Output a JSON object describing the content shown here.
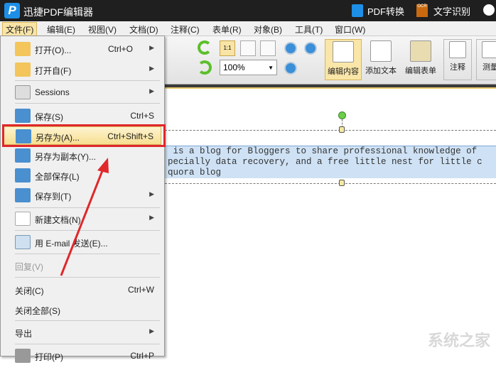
{
  "title_bar": {
    "app_title": "迅捷PDF编辑器",
    "pdf_convert": "PDF转换",
    "ocr_badge": "OCR",
    "ocr": "文字识别",
    "logo_letter": "P"
  },
  "menubar": [
    "文件(F)",
    "编辑(E)",
    "视图(V)",
    "文档(D)",
    "注释(C)",
    "表单(R)",
    "对象(B)",
    "工具(T)",
    "窗口(W)"
  ],
  "toolbar": {
    "zoom_value": "100%",
    "actual_size": "1:1",
    "edit_content": "编辑内容",
    "add_text": "添加文本",
    "edit_form": "编辑表单",
    "annotate": "注释",
    "measure": "测量"
  },
  "document": {
    "lines": [
      " is a blog for Bloggers to share professional knowledge of",
      "pecially data recovery, and a free little nest for little c",
      "quora blog"
    ]
  },
  "file_menu": [
    {
      "label": "打开(O)...",
      "shortcut": "Ctrl+O",
      "submenu": true
    },
    {
      "label": "打开自(F)",
      "submenu": true
    },
    {
      "label": "Sessions",
      "submenu": true
    },
    {
      "label": "保存(S)",
      "shortcut": "Ctrl+S"
    },
    {
      "label": "另存为(A)...",
      "shortcut": "Ctrl+Shift+S"
    },
    {
      "label": "另存为副本(Y)..."
    },
    {
      "label": "全部保存(L)"
    },
    {
      "label": "保存到(T)",
      "submenu": true
    },
    {
      "label": "新建文档(N)",
      "submenu": true
    },
    {
      "label": "用 E-mail 发送(E)..."
    },
    {
      "label": "回复(V)",
      "disabled": true
    },
    {
      "label": "关闭(C)",
      "shortcut": "Ctrl+W"
    },
    {
      "label": "关闭全部(S)"
    },
    {
      "label": "导出",
      "submenu": true
    },
    {
      "label": "打印(P)",
      "shortcut": "Ctrl+P"
    }
  ],
  "watermark": "系统之家",
  "colors": {
    "highlight_box": "#e0272a",
    "selection": "#cfe2f5"
  }
}
